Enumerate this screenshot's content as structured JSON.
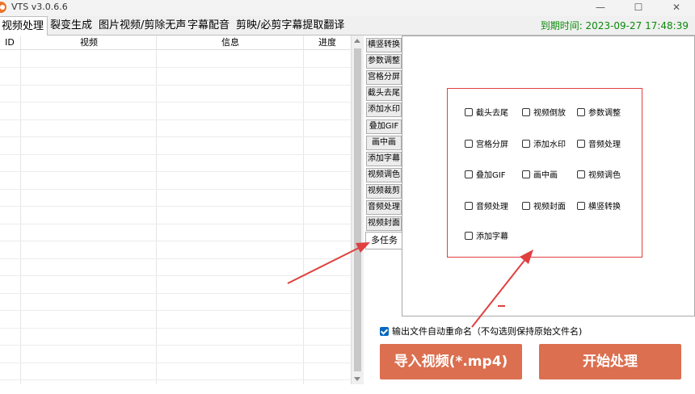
{
  "app": {
    "title": "VTS v3.0.6.6"
  },
  "window_controls": {
    "minimize": "—",
    "maximize": "☐",
    "close": "✕"
  },
  "tabs": [
    {
      "label": "视频处理"
    },
    {
      "label": "裂变生成"
    },
    {
      "label": "图片视频/剪除无声"
    },
    {
      "label": "字幕配音"
    },
    {
      "label": "剪映/必剪字幕提取翻译"
    }
  ],
  "expire_text": "到期时间: 2023-09-27 17:48:39",
  "table": {
    "columns": [
      "ID",
      "视频",
      "信息",
      "进度"
    ]
  },
  "tool_tabs": [
    {
      "label": "横竖转换"
    },
    {
      "label": "参数调整"
    },
    {
      "label": "宫格分屏"
    },
    {
      "label": "截头去尾"
    },
    {
      "label": "添加水印"
    },
    {
      "label": "叠加GIF"
    },
    {
      "label": "画中画"
    },
    {
      "label": "添加字幕"
    },
    {
      "label": "视频调色"
    },
    {
      "label": "视频裁剪"
    },
    {
      "label": "音频处理"
    },
    {
      "label": "视频封面"
    },
    {
      "label": "多任务"
    }
  ],
  "multi_task_options": [
    {
      "label": "截头去尾",
      "checked": false
    },
    {
      "label": "视频倒放",
      "checked": false
    },
    {
      "label": "参数调整",
      "checked": false
    },
    {
      "label": "宫格分屏",
      "checked": false
    },
    {
      "label": "添加水印",
      "checked": false
    },
    {
      "label": "音频处理",
      "checked": false
    },
    {
      "label": "叠加GIF",
      "checked": false
    },
    {
      "label": "画中画",
      "checked": false
    },
    {
      "label": "视频调色",
      "checked": false
    },
    {
      "label": "音频处理",
      "checked": false
    },
    {
      "label": "视频封面",
      "checked": false
    },
    {
      "label": "横竖转换",
      "checked": false
    },
    {
      "label": "添加字幕",
      "checked": false
    }
  ],
  "rename_option": {
    "label": "输出文件自动重命名（不勾选则保持原始文件名)",
    "checked": true
  },
  "buttons": {
    "import": "导入视频(*.mp4)",
    "start": "开始处理"
  },
  "colors": {
    "accent": "#db6f4f",
    "annotation": "#e04040",
    "expire": "#0a8a0a"
  }
}
